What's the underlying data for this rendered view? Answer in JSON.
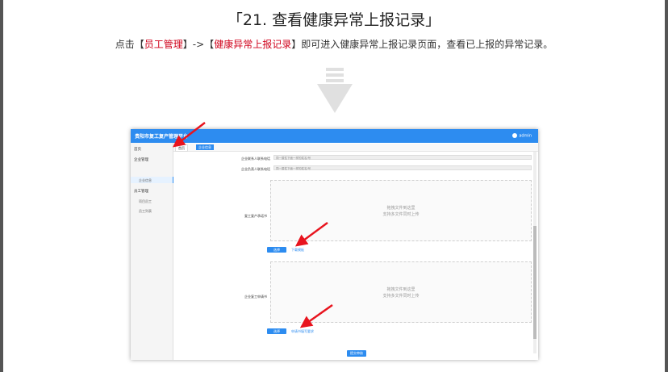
{
  "heading": {
    "title": "「21. 查看健康异常上报记录」",
    "desc_prefix": "点击【",
    "desc_link1": "员工管理",
    "desc_mid": "】->【",
    "desc_link2": "健康异常上报记录",
    "desc_suffix": "】即可进入健康异常上报记录页面，查看已上报的异常记录。"
  },
  "app": {
    "title": "贵阳市复工复产管理平台",
    "user": "admin",
    "tabs": [
      "首页",
      "企业信息"
    ],
    "sidebar": {
      "home": "首页",
      "enterprise": "企业管理",
      "enterprise_sub": "企业信息",
      "staff": "员工管理",
      "staff_sub1": "项目员工",
      "staff_sub2": "员工列表"
    },
    "form": {
      "field1_label": "企业联系人联系电话",
      "field1_value": "同一属性下面一样的姓名/号",
      "field2_label": "企业负责人联系电话",
      "field2_value": "同一属性下面一样的姓名/号",
      "upload1_label": "复工复产承诺书",
      "upload2_label": "企业复工申请书",
      "upload_hint1": "拖拽文件到这里",
      "upload_hint2": "支持多文件同时上传",
      "select_btn": "选择",
      "download1": "下载模板",
      "download2": "申请书填写要求",
      "submit": "提交审核"
    }
  },
  "colors": {
    "accent": "#2d8cf0",
    "highlight": "#d0021b"
  }
}
